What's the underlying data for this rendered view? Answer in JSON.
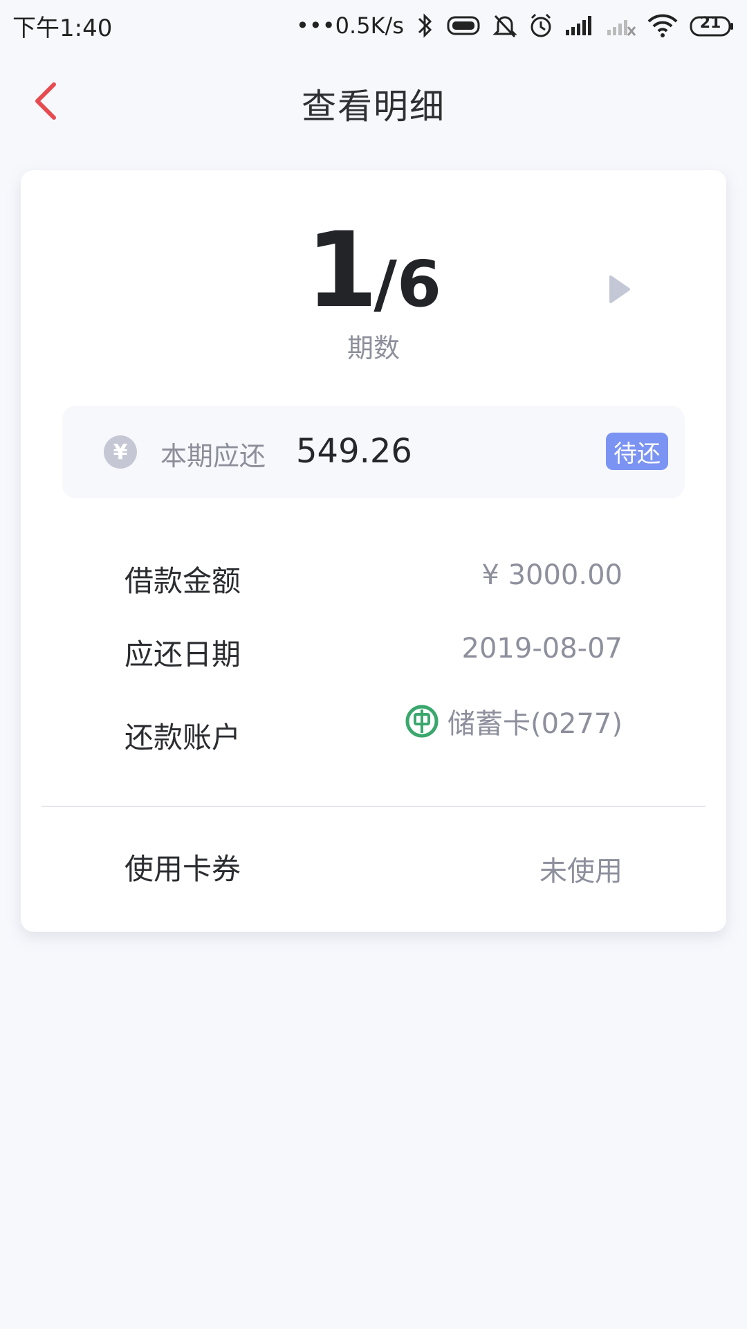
{
  "status_bar": {
    "time": "下午1:40",
    "network_speed": "•••0.5K/s",
    "battery_level": "21",
    "icons": [
      "bluetooth-icon",
      "vibrate-icon",
      "mute-bell-icon",
      "alarm-icon",
      "signal-icon",
      "signal-off-icon",
      "wifi-icon",
      "battery-icon"
    ]
  },
  "header": {
    "title": "查看明细",
    "back_icon": "chevron-left-icon",
    "accent_color": "#e74b4f"
  },
  "period": {
    "current": "1",
    "separator": "/",
    "total": "6",
    "label": "期数",
    "next_icon": "play-right-icon"
  },
  "due": {
    "currency_icon": "yen-icon",
    "currency_symbol": "¥",
    "label": "本期应还",
    "amount": "549.26",
    "status": "待还",
    "status_color": "#7b93f2"
  },
  "details": {
    "loan_amount_label": "借款金额",
    "loan_amount_value": "¥ 3000.00",
    "due_date_label": "应还日期",
    "due_date_value": "2019-08-07",
    "account_label": "还款账户",
    "account_value": "储蓄卡(0277)",
    "bank_icon": "bank-logo-icon",
    "bank_color": "#3aa76d"
  },
  "coupon": {
    "label": "使用卡券",
    "value": "未使用"
  }
}
